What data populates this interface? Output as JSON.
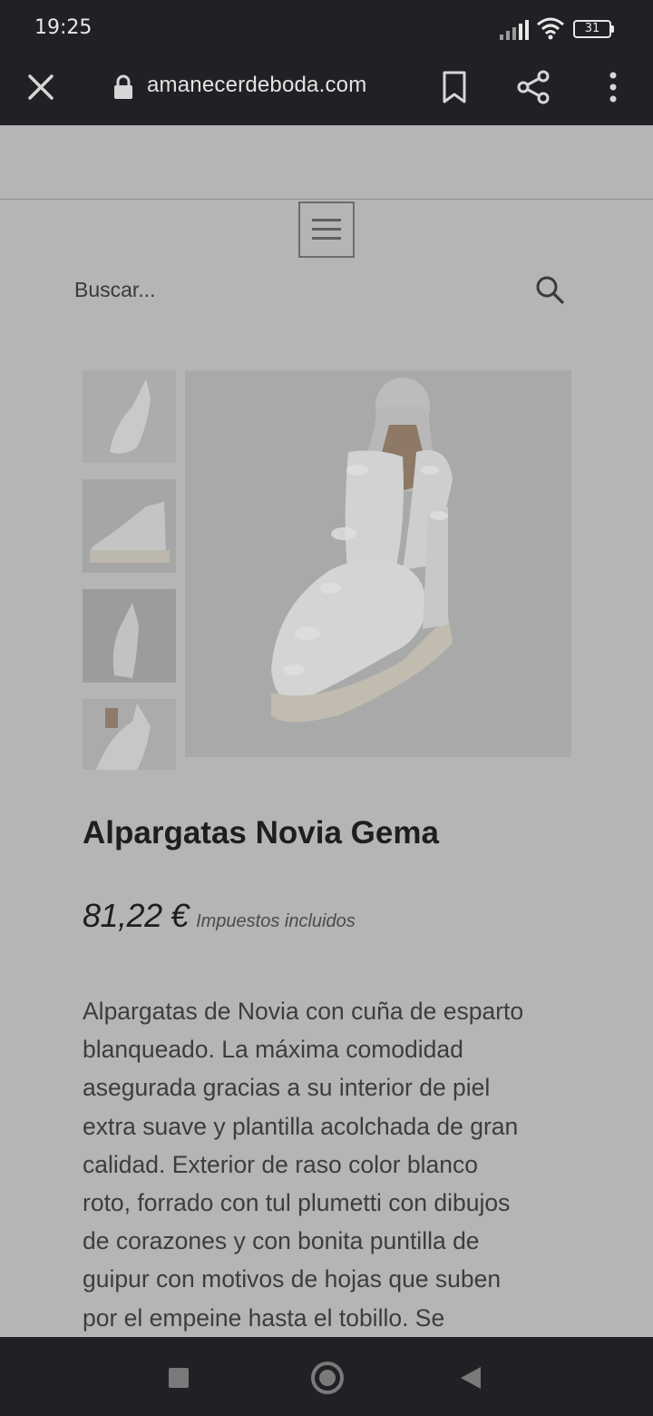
{
  "status_bar": {
    "time": "19:25",
    "battery": "31",
    "icons": [
      "signal-icon",
      "wifi-icon",
      "battery-icon"
    ]
  },
  "browser": {
    "url": "amanecerdeboda.com",
    "icons": [
      "close-icon",
      "lock-icon",
      "bookmark-icon",
      "share-icon",
      "more-vert-icon"
    ]
  },
  "site": {
    "menu_icon": "hamburger-icon",
    "search": {
      "placeholder": "Buscar...",
      "icon": "search-icon"
    }
  },
  "product": {
    "thumbnails": [
      "thumbnail-1",
      "thumbnail-2",
      "thumbnail-3",
      "thumbnail-4"
    ],
    "title": "Alpargatas Novia Gema",
    "price": "81,22 €",
    "tax_note": "Impuestos incluidos",
    "description_lines": [
      "Alpargatas de Novia con cuña de esparto",
      "blanqueado. La máxima comodidad",
      "asegurada gracias a su interior de piel",
      "extra suave y plantilla acolchada de gran",
      "calidad. Exterior de raso color blanco",
      "roto, forrado con tul plumetti con dibujos",
      "de corazones y con bonita puntilla de",
      "guipur con motivos de hojas que suben",
      "por el empeine hasta el tobillo. Se"
    ]
  },
  "nav_bar": {
    "icons": [
      "recents-icon",
      "home-icon",
      "back-icon"
    ]
  },
  "colors": {
    "system_bar": "#202124",
    "page_overlay": "#b5b5b5",
    "text_dark": "#1e1e1e"
  }
}
